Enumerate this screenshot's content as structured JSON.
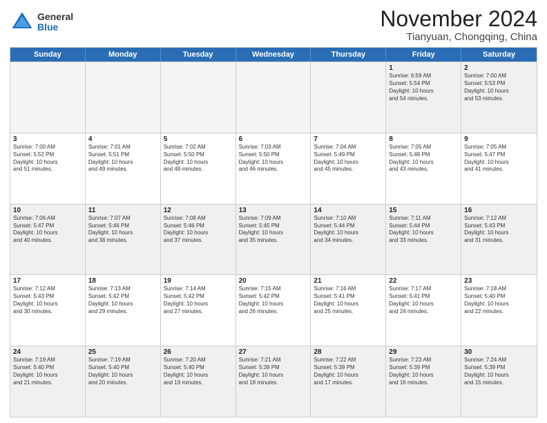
{
  "logo": {
    "general": "General",
    "blue": "Blue"
  },
  "title": "November 2024",
  "location": "Tianyuan, Chongqing, China",
  "header": {
    "days": [
      "Sunday",
      "Monday",
      "Tuesday",
      "Wednesday",
      "Thursday",
      "Friday",
      "Saturday"
    ]
  },
  "rows": [
    [
      {
        "day": "",
        "empty": true
      },
      {
        "day": "",
        "empty": true
      },
      {
        "day": "",
        "empty": true
      },
      {
        "day": "",
        "empty": true
      },
      {
        "day": "",
        "empty": true
      },
      {
        "day": "1",
        "info": "Sunrise: 6:59 AM\nSunset: 5:54 PM\nDaylight: 10 hours\nand 54 minutes."
      },
      {
        "day": "2",
        "info": "Sunrise: 7:00 AM\nSunset: 5:53 PM\nDaylight: 10 hours\nand 53 minutes."
      }
    ],
    [
      {
        "day": "3",
        "info": "Sunrise: 7:00 AM\nSunset: 5:52 PM\nDaylight: 10 hours\nand 51 minutes."
      },
      {
        "day": "4",
        "info": "Sunrise: 7:01 AM\nSunset: 5:51 PM\nDaylight: 10 hours\nand 49 minutes."
      },
      {
        "day": "5",
        "info": "Sunrise: 7:02 AM\nSunset: 5:50 PM\nDaylight: 10 hours\nand 48 minutes."
      },
      {
        "day": "6",
        "info": "Sunrise: 7:03 AM\nSunset: 5:50 PM\nDaylight: 10 hours\nand 46 minutes."
      },
      {
        "day": "7",
        "info": "Sunrise: 7:04 AM\nSunset: 5:49 PM\nDaylight: 10 hours\nand 45 minutes."
      },
      {
        "day": "8",
        "info": "Sunrise: 7:05 AM\nSunset: 5:48 PM\nDaylight: 10 hours\nand 43 minutes."
      },
      {
        "day": "9",
        "info": "Sunrise: 7:05 AM\nSunset: 5:47 PM\nDaylight: 10 hours\nand 41 minutes."
      }
    ],
    [
      {
        "day": "10",
        "info": "Sunrise: 7:06 AM\nSunset: 5:47 PM\nDaylight: 10 hours\nand 40 minutes."
      },
      {
        "day": "11",
        "info": "Sunrise: 7:07 AM\nSunset: 5:46 PM\nDaylight: 10 hours\nand 38 minutes."
      },
      {
        "day": "12",
        "info": "Sunrise: 7:08 AM\nSunset: 5:46 PM\nDaylight: 10 hours\nand 37 minutes."
      },
      {
        "day": "13",
        "info": "Sunrise: 7:09 AM\nSunset: 5:45 PM\nDaylight: 10 hours\nand 35 minutes."
      },
      {
        "day": "14",
        "info": "Sunrise: 7:10 AM\nSunset: 5:44 PM\nDaylight: 10 hours\nand 34 minutes."
      },
      {
        "day": "15",
        "info": "Sunrise: 7:11 AM\nSunset: 5:44 PM\nDaylight: 10 hours\nand 33 minutes."
      },
      {
        "day": "16",
        "info": "Sunrise: 7:12 AM\nSunset: 5:43 PM\nDaylight: 10 hours\nand 31 minutes."
      }
    ],
    [
      {
        "day": "17",
        "info": "Sunrise: 7:12 AM\nSunset: 5:43 PM\nDaylight: 10 hours\nand 30 minutes."
      },
      {
        "day": "18",
        "info": "Sunrise: 7:13 AM\nSunset: 5:42 PM\nDaylight: 10 hours\nand 29 minutes."
      },
      {
        "day": "19",
        "info": "Sunrise: 7:14 AM\nSunset: 5:42 PM\nDaylight: 10 hours\nand 27 minutes."
      },
      {
        "day": "20",
        "info": "Sunrise: 7:15 AM\nSunset: 5:42 PM\nDaylight: 10 hours\nand 26 minutes."
      },
      {
        "day": "21",
        "info": "Sunrise: 7:16 AM\nSunset: 5:41 PM\nDaylight: 10 hours\nand 25 minutes."
      },
      {
        "day": "22",
        "info": "Sunrise: 7:17 AM\nSunset: 5:41 PM\nDaylight: 10 hours\nand 24 minutes."
      },
      {
        "day": "23",
        "info": "Sunrise: 7:18 AM\nSunset: 5:40 PM\nDaylight: 10 hours\nand 22 minutes."
      }
    ],
    [
      {
        "day": "24",
        "info": "Sunrise: 7:19 AM\nSunset: 5:40 PM\nDaylight: 10 hours\nand 21 minutes."
      },
      {
        "day": "25",
        "info": "Sunrise: 7:19 AM\nSunset: 5:40 PM\nDaylight: 10 hours\nand 20 minutes."
      },
      {
        "day": "26",
        "info": "Sunrise: 7:20 AM\nSunset: 5:40 PM\nDaylight: 10 hours\nand 19 minutes."
      },
      {
        "day": "27",
        "info": "Sunrise: 7:21 AM\nSunset: 5:39 PM\nDaylight: 10 hours\nand 18 minutes."
      },
      {
        "day": "28",
        "info": "Sunrise: 7:22 AM\nSunset: 5:39 PM\nDaylight: 10 hours\nand 17 minutes."
      },
      {
        "day": "29",
        "info": "Sunrise: 7:23 AM\nSunset: 5:39 PM\nDaylight: 10 hours\nand 16 minutes."
      },
      {
        "day": "30",
        "info": "Sunrise: 7:24 AM\nSunset: 5:39 PM\nDaylight: 10 hours\nand 15 minutes."
      }
    ]
  ]
}
